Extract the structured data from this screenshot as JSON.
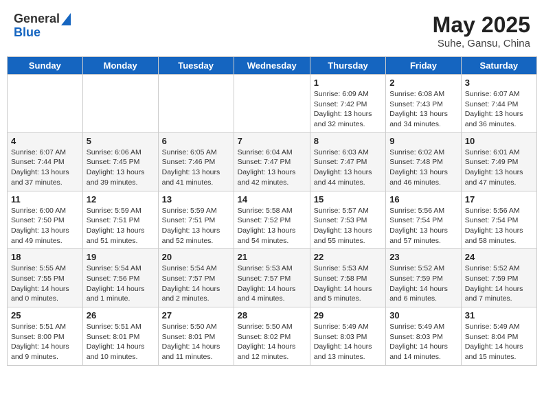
{
  "header": {
    "logo_general": "General",
    "logo_blue": "Blue",
    "month": "May 2025",
    "location": "Suhe, Gansu, China"
  },
  "weekdays": [
    "Sunday",
    "Monday",
    "Tuesday",
    "Wednesday",
    "Thursday",
    "Friday",
    "Saturday"
  ],
  "weeks": [
    [
      {
        "day": "",
        "info": ""
      },
      {
        "day": "",
        "info": ""
      },
      {
        "day": "",
        "info": ""
      },
      {
        "day": "",
        "info": ""
      },
      {
        "day": "1",
        "info": "Sunrise: 6:09 AM\nSunset: 7:42 PM\nDaylight: 13 hours\nand 32 minutes."
      },
      {
        "day": "2",
        "info": "Sunrise: 6:08 AM\nSunset: 7:43 PM\nDaylight: 13 hours\nand 34 minutes."
      },
      {
        "day": "3",
        "info": "Sunrise: 6:07 AM\nSunset: 7:44 PM\nDaylight: 13 hours\nand 36 minutes."
      }
    ],
    [
      {
        "day": "4",
        "info": "Sunrise: 6:07 AM\nSunset: 7:44 PM\nDaylight: 13 hours\nand 37 minutes."
      },
      {
        "day": "5",
        "info": "Sunrise: 6:06 AM\nSunset: 7:45 PM\nDaylight: 13 hours\nand 39 minutes."
      },
      {
        "day": "6",
        "info": "Sunrise: 6:05 AM\nSunset: 7:46 PM\nDaylight: 13 hours\nand 41 minutes."
      },
      {
        "day": "7",
        "info": "Sunrise: 6:04 AM\nSunset: 7:47 PM\nDaylight: 13 hours\nand 42 minutes."
      },
      {
        "day": "8",
        "info": "Sunrise: 6:03 AM\nSunset: 7:47 PM\nDaylight: 13 hours\nand 44 minutes."
      },
      {
        "day": "9",
        "info": "Sunrise: 6:02 AM\nSunset: 7:48 PM\nDaylight: 13 hours\nand 46 minutes."
      },
      {
        "day": "10",
        "info": "Sunrise: 6:01 AM\nSunset: 7:49 PM\nDaylight: 13 hours\nand 47 minutes."
      }
    ],
    [
      {
        "day": "11",
        "info": "Sunrise: 6:00 AM\nSunset: 7:50 PM\nDaylight: 13 hours\nand 49 minutes."
      },
      {
        "day": "12",
        "info": "Sunrise: 5:59 AM\nSunset: 7:51 PM\nDaylight: 13 hours\nand 51 minutes."
      },
      {
        "day": "13",
        "info": "Sunrise: 5:59 AM\nSunset: 7:51 PM\nDaylight: 13 hours\nand 52 minutes."
      },
      {
        "day": "14",
        "info": "Sunrise: 5:58 AM\nSunset: 7:52 PM\nDaylight: 13 hours\nand 54 minutes."
      },
      {
        "day": "15",
        "info": "Sunrise: 5:57 AM\nSunset: 7:53 PM\nDaylight: 13 hours\nand 55 minutes."
      },
      {
        "day": "16",
        "info": "Sunrise: 5:56 AM\nSunset: 7:54 PM\nDaylight: 13 hours\nand 57 minutes."
      },
      {
        "day": "17",
        "info": "Sunrise: 5:56 AM\nSunset: 7:54 PM\nDaylight: 13 hours\nand 58 minutes."
      }
    ],
    [
      {
        "day": "18",
        "info": "Sunrise: 5:55 AM\nSunset: 7:55 PM\nDaylight: 14 hours\nand 0 minutes."
      },
      {
        "day": "19",
        "info": "Sunrise: 5:54 AM\nSunset: 7:56 PM\nDaylight: 14 hours\nand 1 minute."
      },
      {
        "day": "20",
        "info": "Sunrise: 5:54 AM\nSunset: 7:57 PM\nDaylight: 14 hours\nand 2 minutes."
      },
      {
        "day": "21",
        "info": "Sunrise: 5:53 AM\nSunset: 7:57 PM\nDaylight: 14 hours\nand 4 minutes."
      },
      {
        "day": "22",
        "info": "Sunrise: 5:53 AM\nSunset: 7:58 PM\nDaylight: 14 hours\nand 5 minutes."
      },
      {
        "day": "23",
        "info": "Sunrise: 5:52 AM\nSunset: 7:59 PM\nDaylight: 14 hours\nand 6 minutes."
      },
      {
        "day": "24",
        "info": "Sunrise: 5:52 AM\nSunset: 7:59 PM\nDaylight: 14 hours\nand 7 minutes."
      }
    ],
    [
      {
        "day": "25",
        "info": "Sunrise: 5:51 AM\nSunset: 8:00 PM\nDaylight: 14 hours\nand 9 minutes."
      },
      {
        "day": "26",
        "info": "Sunrise: 5:51 AM\nSunset: 8:01 PM\nDaylight: 14 hours\nand 10 minutes."
      },
      {
        "day": "27",
        "info": "Sunrise: 5:50 AM\nSunset: 8:01 PM\nDaylight: 14 hours\nand 11 minutes."
      },
      {
        "day": "28",
        "info": "Sunrise: 5:50 AM\nSunset: 8:02 PM\nDaylight: 14 hours\nand 12 minutes."
      },
      {
        "day": "29",
        "info": "Sunrise: 5:49 AM\nSunset: 8:03 PM\nDaylight: 14 hours\nand 13 minutes."
      },
      {
        "day": "30",
        "info": "Sunrise: 5:49 AM\nSunset: 8:03 PM\nDaylight: 14 hours\nand 14 minutes."
      },
      {
        "day": "31",
        "info": "Sunrise: 5:49 AM\nSunset: 8:04 PM\nDaylight: 14 hours\nand 15 minutes."
      }
    ]
  ]
}
